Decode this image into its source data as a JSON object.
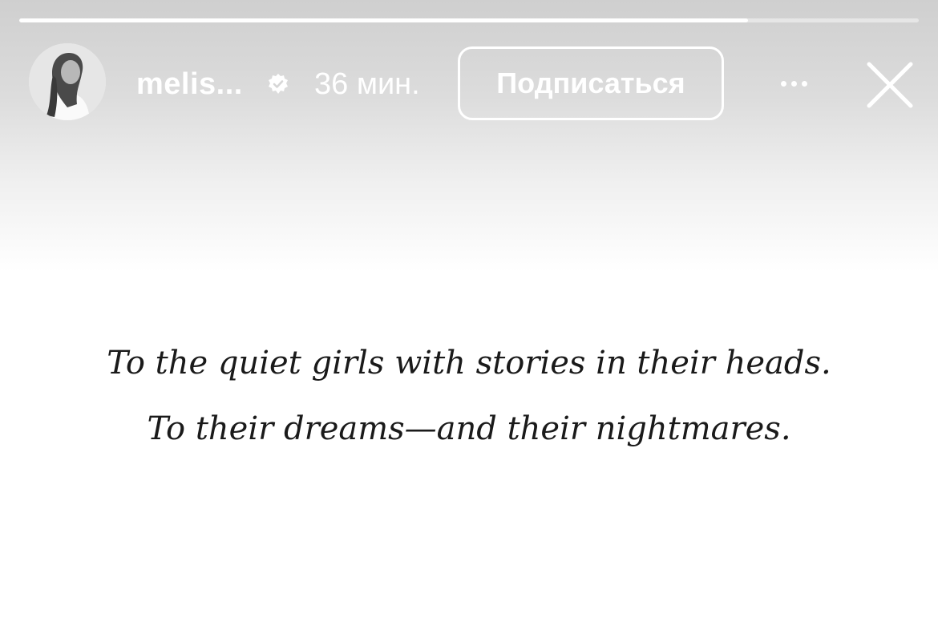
{
  "story": {
    "progress_percent": 81
  },
  "header": {
    "username": "melis...",
    "verified_icon": "verified-badge-icon",
    "time": "36 мин.",
    "follow_label": "Подписаться",
    "more_icon": "more-horizontal-icon",
    "close_icon": "close-icon"
  },
  "content": {
    "line1": "To the quiet girls with stories in their heads.",
    "line2": "To their dreams—and their nightmares."
  },
  "colors": {
    "text": "#1a1a1a",
    "overlay_text": "#ffffff"
  }
}
